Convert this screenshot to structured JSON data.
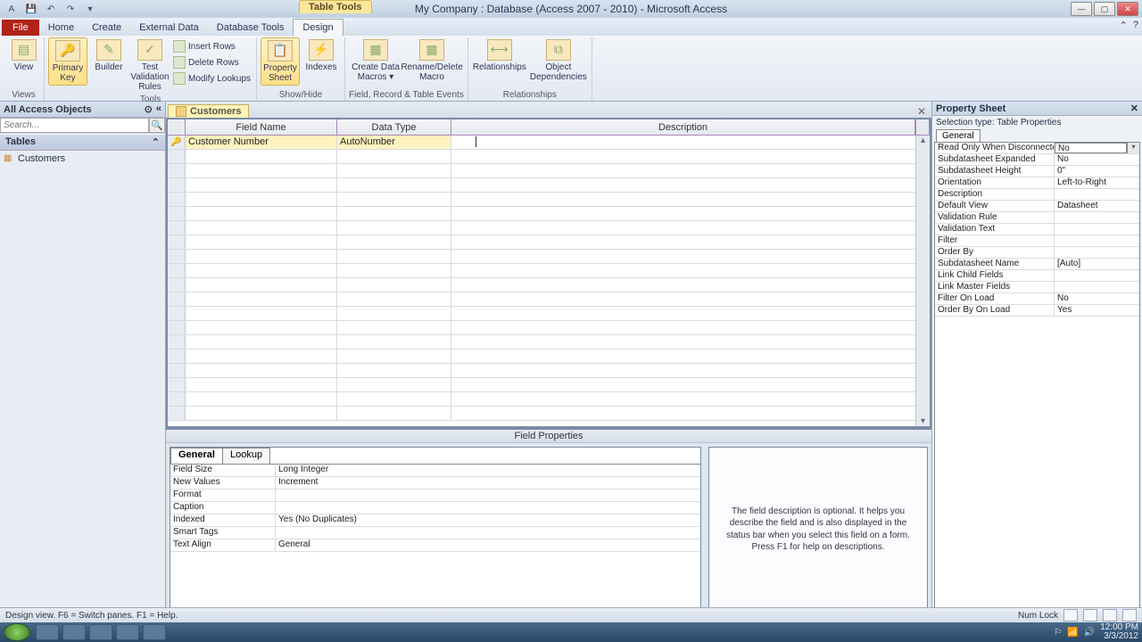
{
  "titlebar": {
    "title": "My Company : Database (Access 2007 - 2010) - Microsoft Access",
    "table_tools": "Table Tools"
  },
  "ribbon_tabs": {
    "file": "File",
    "home": "Home",
    "create": "Create",
    "external": "External Data",
    "dbtools": "Database Tools",
    "design": "Design"
  },
  "ribbon": {
    "views_group": "Views",
    "view": "View",
    "primary_key": "Primary Key",
    "builder": "Builder",
    "test_validation": "Test Validation Rules",
    "insert_rows": "Insert Rows",
    "delete_rows": "Delete Rows",
    "modify_lookups": "Modify Lookups",
    "tools_group": "Tools",
    "property_sheet": "Property Sheet",
    "indexes": "Indexes",
    "showhide_group": "Show/Hide",
    "create_macros": "Create Data Macros ▾",
    "rename_macro": "Rename/Delete Macro",
    "events_group": "Field, Record & Table Events",
    "relationships": "Relationships",
    "obj_dep": "Object Dependencies",
    "rel_group": "Relationships"
  },
  "nav": {
    "header": "All Access Objects",
    "search_placeholder": "Search...",
    "group_tables": "Tables",
    "item_customers": "Customers"
  },
  "doc_tab": {
    "label": "Customers"
  },
  "design_grid": {
    "col_field": "Field Name",
    "col_type": "Data Type",
    "col_desc": "Description",
    "rows": [
      {
        "field": "Customer Number",
        "type": "AutoNumber",
        "desc": ""
      }
    ]
  },
  "field_props": {
    "title": "Field Properties",
    "tab_general": "General",
    "tab_lookup": "Lookup",
    "rows": [
      {
        "name": "Field Size",
        "value": "Long Integer"
      },
      {
        "name": "New Values",
        "value": "Increment"
      },
      {
        "name": "Format",
        "value": ""
      },
      {
        "name": "Caption",
        "value": ""
      },
      {
        "name": "Indexed",
        "value": "Yes (No Duplicates)"
      },
      {
        "name": "Smart Tags",
        "value": ""
      },
      {
        "name": "Text Align",
        "value": "General"
      }
    ],
    "help": "The field description is optional. It helps you describe the field and is also displayed in the status bar when you select this field on a form. Press F1 for help on descriptions."
  },
  "property_sheet": {
    "title": "Property Sheet",
    "selection": "Selection type:  Table Properties",
    "tab_general": "General",
    "rows": [
      {
        "name": "Read Only When Disconnected",
        "value": "No"
      },
      {
        "name": "Subdatasheet Expanded",
        "value": "No"
      },
      {
        "name": "Subdatasheet Height",
        "value": "0\""
      },
      {
        "name": "Orientation",
        "value": "Left-to-Right"
      },
      {
        "name": "Description",
        "value": ""
      },
      {
        "name": "Default View",
        "value": "Datasheet"
      },
      {
        "name": "Validation Rule",
        "value": ""
      },
      {
        "name": "Validation Text",
        "value": ""
      },
      {
        "name": "Filter",
        "value": ""
      },
      {
        "name": "Order By",
        "value": ""
      },
      {
        "name": "Subdatasheet Name",
        "value": "[Auto]"
      },
      {
        "name": "Link Child Fields",
        "value": ""
      },
      {
        "name": "Link Master Fields",
        "value": ""
      },
      {
        "name": "Filter On Load",
        "value": "No"
      },
      {
        "name": "Order By On Load",
        "value": "Yes"
      }
    ]
  },
  "statusbar": {
    "left": "Design view.   F6 = Switch panes.   F1 = Help.",
    "numlock": "Num Lock"
  },
  "taskbar": {
    "time": "12:00 PM",
    "date": "3/3/2012"
  }
}
